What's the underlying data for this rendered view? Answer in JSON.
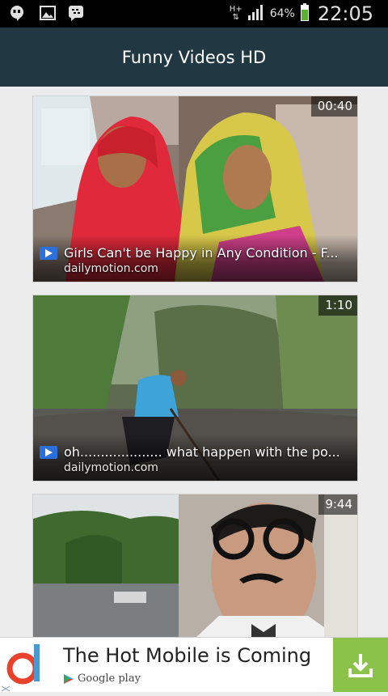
{
  "status_bar": {
    "network_type": "H+",
    "battery_percent": "64%",
    "time": "22:05",
    "icons": [
      "hangouts-icon",
      "image-notification-icon",
      "bbm-icon",
      "signal-icon",
      "battery-icon"
    ]
  },
  "app_bar": {
    "title": "Funny Videos HD"
  },
  "videos": [
    {
      "duration": "00:40",
      "title": "Girls Can't be Happy in Any Condition - F...",
      "source": "dailymotion.com"
    },
    {
      "duration": "1:10",
      "title": "oh.................... what happen with the po...",
      "source": "dailymotion.com"
    },
    {
      "duration": "9:44",
      "title": "",
      "source": ""
    }
  ],
  "ad": {
    "title": "The Hot Mobile is Coming",
    "store_label": "Google play",
    "accent": "#8bc34a"
  },
  "colors": {
    "app_bar": "#213843",
    "background": "#ececec",
    "play_badge": "#2a6fdc"
  }
}
